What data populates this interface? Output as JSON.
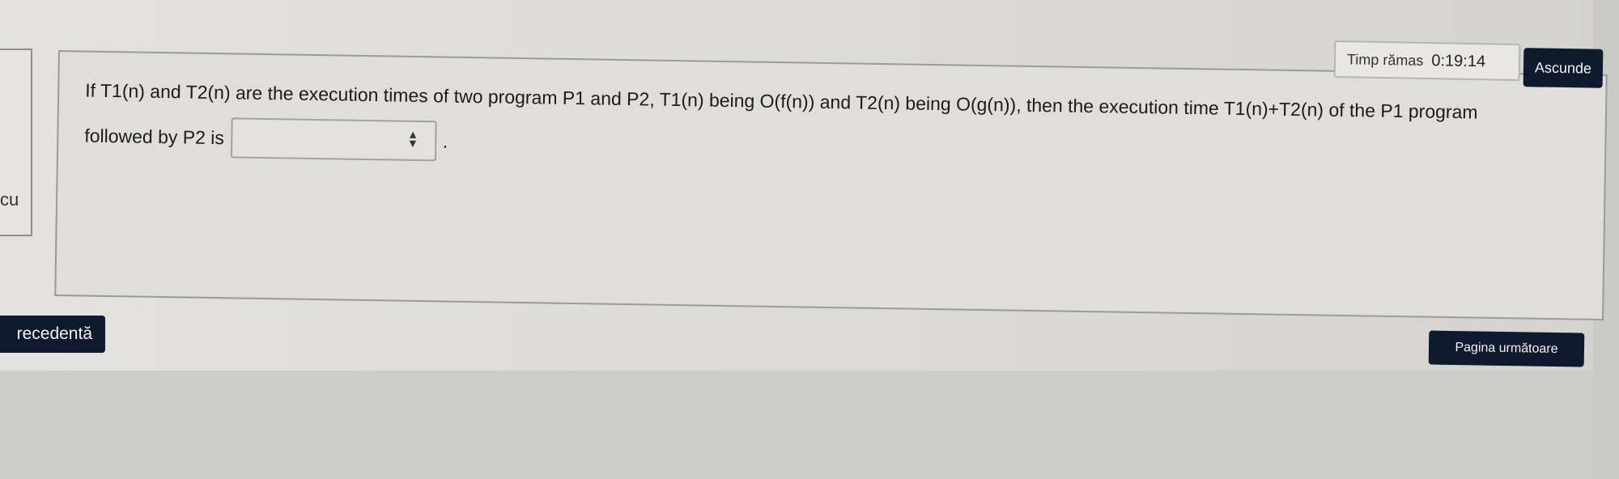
{
  "question": {
    "line1": "If T1(n) and T2(n) are the execution times of two program P1 and P2, T1(n) being O(f(n)) and T2(n) being O(g(n)), then the execution time T1(n)+T2(n) of the P1 program",
    "line2_prefix": "followed by P2 is",
    "select_value": "",
    "select_icon": "updown-arrows-icon",
    "line2_suffix": "."
  },
  "timer": {
    "label": "Timp rămas",
    "value": "0:19:14"
  },
  "hide_button": "Ascunde",
  "nav": {
    "previous_label": "recedentă",
    "next_label": "Pagina următoare"
  },
  "sidebar": {
    "fragment": "cu"
  },
  "colors": {
    "button_bg": "#0f1a2e",
    "button_text": "#f2f2f2",
    "page_bg": "#dedcd8"
  }
}
